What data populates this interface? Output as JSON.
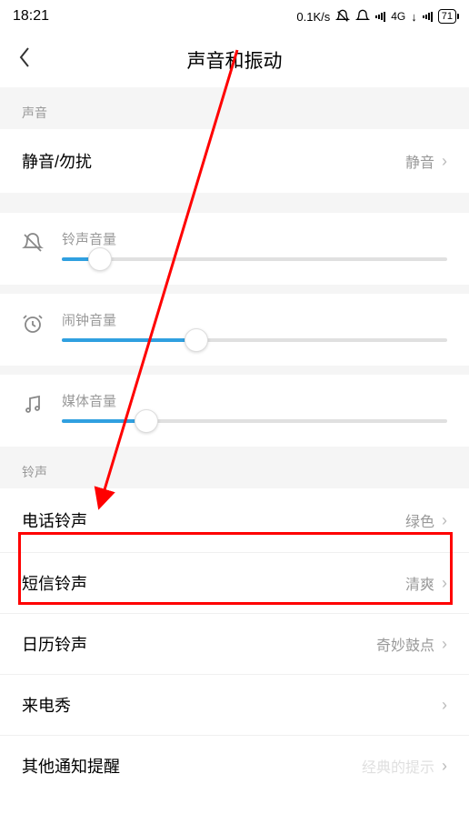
{
  "status": {
    "time": "18:21",
    "netspeed": "0.1K/s",
    "network": "4G",
    "battery": "71"
  },
  "header": {
    "title": "声音和振动"
  },
  "sections": {
    "sound_label": "声音",
    "ring_label": "铃声"
  },
  "silent": {
    "label": "静音/勿扰",
    "value": "静音"
  },
  "sliders": {
    "ring": {
      "label": "铃声音量",
      "pct": 10
    },
    "alarm": {
      "label": "闹钟音量",
      "pct": 35
    },
    "media": {
      "label": "媒体音量",
      "pct": 22
    }
  },
  "ringtones": {
    "phone": {
      "label": "电话铃声",
      "value": "绿色"
    },
    "sms": {
      "label": "短信铃声",
      "value": "清爽"
    },
    "calendar": {
      "label": "日历铃声",
      "value": "奇妙鼓点"
    },
    "callershow": {
      "label": "来电秀",
      "value": ""
    },
    "other": {
      "label": "其他通知提醒",
      "value": "经典的提示"
    }
  }
}
